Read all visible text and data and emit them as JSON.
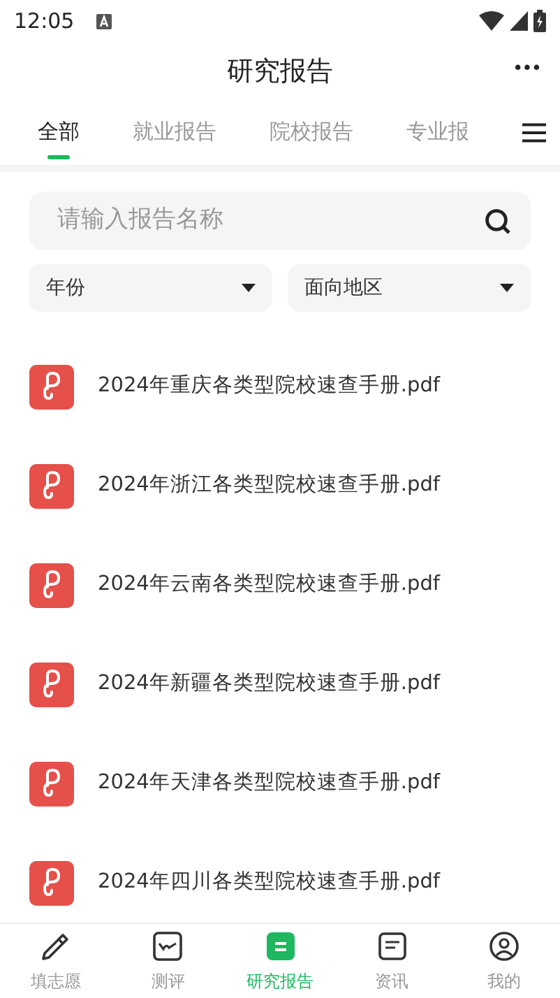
{
  "status_bar": {
    "time": "12:05"
  },
  "header": {
    "title": "研究报告",
    "more": "•••"
  },
  "tabs": [
    {
      "label": "全部",
      "selected": true
    },
    {
      "label": "就业报告",
      "selected": false
    },
    {
      "label": "院校报告",
      "selected": false
    },
    {
      "label": "专业报",
      "selected": false
    }
  ],
  "search": {
    "placeholder": "请输入报告名称"
  },
  "filters": [
    {
      "label": "年份"
    },
    {
      "label": "面向地区"
    }
  ],
  "files": [
    {
      "name": "2024年重庆各类型院校速查手册.pdf"
    },
    {
      "name": "2024年浙江各类型院校速查手册.pdf"
    },
    {
      "name": "2024年云南各类型院校速查手册.pdf"
    },
    {
      "name": "2024年新疆各类型院校速查手册.pdf"
    },
    {
      "name": "2024年天津各类型院校速查手册.pdf"
    },
    {
      "name": "2024年四川各类型院校速查手册.pdf"
    }
  ],
  "bottom_nav": [
    {
      "label": "填志愿",
      "kind": "pencil",
      "selected": false
    },
    {
      "label": "测评",
      "kind": "chart",
      "selected": false
    },
    {
      "label": "研究报告",
      "kind": "report",
      "selected": true
    },
    {
      "label": "资讯",
      "kind": "news",
      "selected": false
    },
    {
      "label": "我的",
      "kind": "person",
      "selected": false
    }
  ]
}
